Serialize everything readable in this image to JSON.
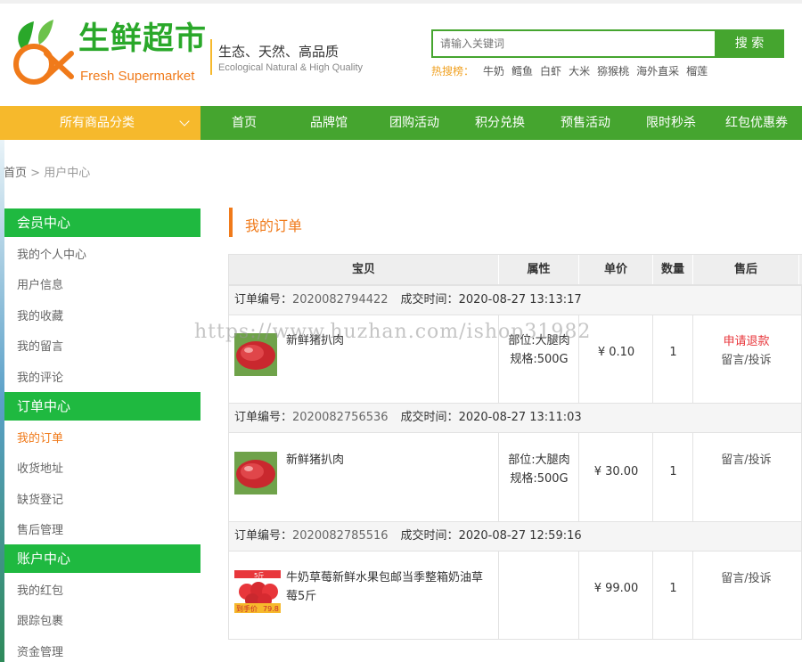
{
  "brand": {
    "name_cn": "生鲜超市",
    "name_en": "Fresh Supermarket",
    "slogan_cn": "生态、天然、高品质",
    "slogan_en": "Ecological Natural & High Quality"
  },
  "search": {
    "placeholder": "请输入关键词",
    "button": "搜 索",
    "hot_label": "热搜榜：",
    "hot_items": [
      "牛奶",
      "鳕鱼",
      "白虾",
      "大米",
      "猕猴桃",
      "海外直采",
      "榴莲"
    ]
  },
  "nav": {
    "category": "所有商品分类",
    "items": [
      "首页",
      "品牌馆",
      "团购活动",
      "积分兑换",
      "预售活动",
      "限时秒杀",
      "红包优惠券"
    ]
  },
  "breadcrumb": {
    "home": "首页",
    "separator": ">",
    "current": "用户中心"
  },
  "sidebar": {
    "sections": [
      {
        "title": "会员中心",
        "items": [
          "我的个人中心",
          "用户信息",
          "我的收藏",
          "我的留言",
          "我的评论"
        ]
      },
      {
        "title": "订单中心",
        "items": [
          "我的订单",
          "收货地址",
          "缺货登记",
          "售后管理"
        ]
      },
      {
        "title": "账户中心",
        "items": [
          "我的红包",
          "跟踪包裹",
          "资金管理"
        ]
      }
    ],
    "active": "我的订单"
  },
  "main": {
    "title": "我的订单",
    "columns": [
      "宝贝",
      "属性",
      "单价",
      "数量",
      "售后"
    ],
    "order_no_label": "订单编号：",
    "time_label": "成交时间：",
    "orders": [
      {
        "order_no": "2020082794422",
        "time": "2020-08-27 13:13:17",
        "product": "新鲜猪扒肉",
        "attr_part": "部位:大腿肉",
        "attr_spec": "规格:500G",
        "price": "¥ 0.10",
        "qty": "1",
        "refund": "申请退款",
        "comment": "留言/投诉"
      },
      {
        "order_no": "2020082756536",
        "time": "2020-08-27 13:11:03",
        "product": "新鲜猪扒肉",
        "attr_part": "部位:大腿肉",
        "attr_spec": "规格:500G",
        "price": "¥ 30.00",
        "qty": "1",
        "comment": "留言/投诉"
      },
      {
        "order_no": "2020082785516",
        "time": "2020-08-27 12:59:16",
        "product": "牛奶草莓新鲜水果包邮当季整箱奶油草莓5斤",
        "price": "¥ 99.00",
        "qty": "1",
        "comment": "留言/投诉",
        "thumb_text": [
          "到手价",
          "5斤",
          "79.8"
        ]
      }
    ]
  },
  "watermark": "https://www.huzhan.com/ishop31982",
  "colors": {
    "green": "#45a52f",
    "sidebar_green": "#1fb940",
    "orange": "#f07a1a",
    "yellow": "#f6b92c",
    "red": "#e8363b"
  }
}
